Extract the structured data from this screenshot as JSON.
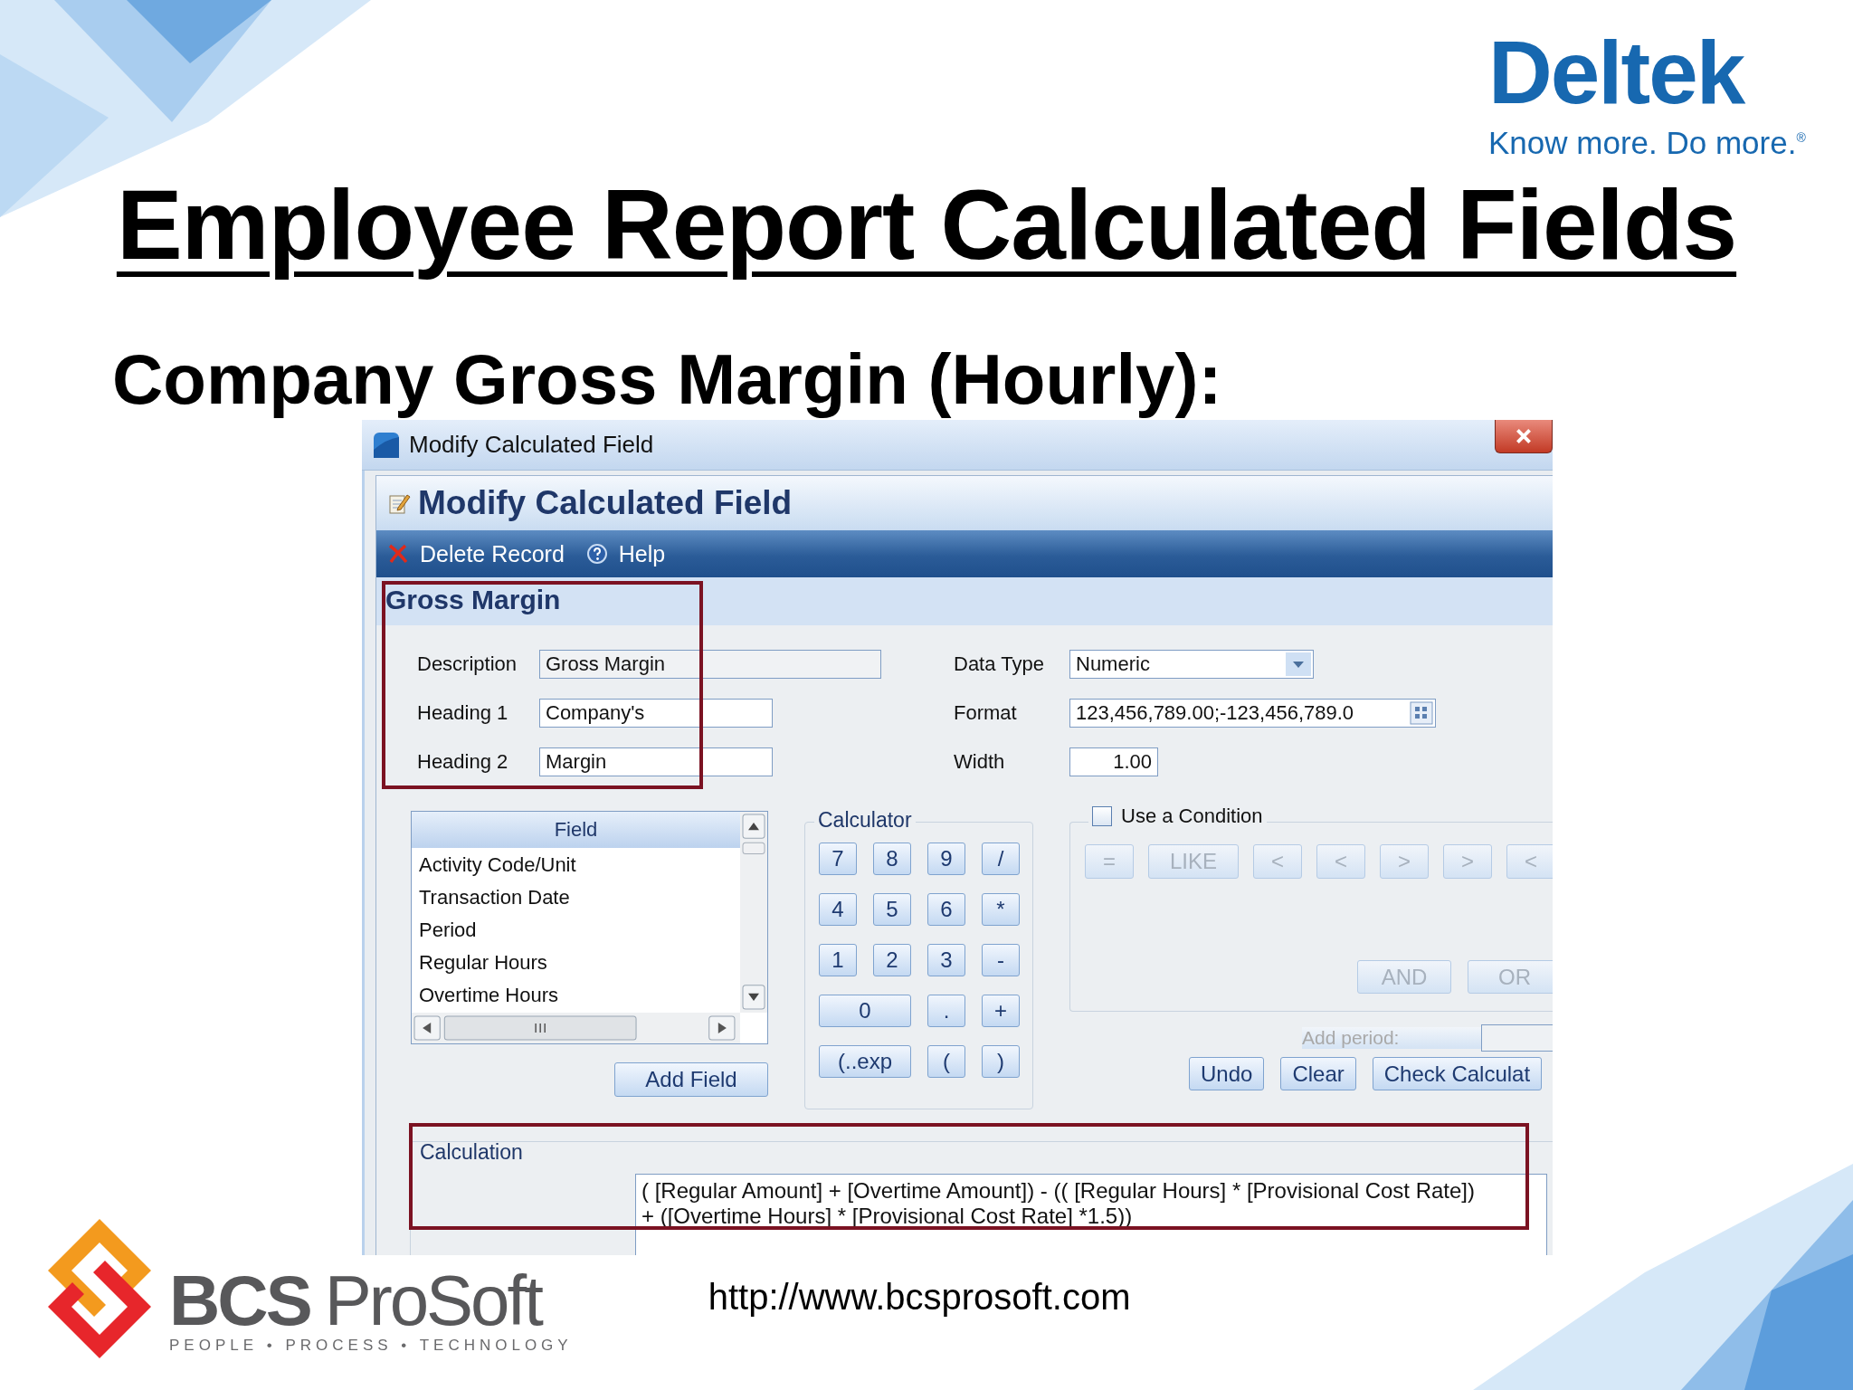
{
  "slide": {
    "brand_top": {
      "name": "Deltek",
      "tagline": "Know more. Do more.$^{®}$"
    },
    "title": "Employee Report Calculated Fields",
    "subtitle": "Company Gross Margin (Hourly):",
    "brand_bottom": {
      "name_bold": "BCS",
      "name": "ProSoft",
      "tagline": "PEOPLE • PROCESS • TECHNOLOGY"
    },
    "url": "http://www.bcsprosoft.com"
  },
  "window": {
    "title": "Modify Calculated Field"
  },
  "form": {
    "heading": "Modify Calculated Field",
    "toolbar": [
      {
        "kind": "delete",
        "label": "Delete Record"
      },
      {
        "kind": "help",
        "label": "Help"
      }
    ],
    "section": "Gross Margin",
    "fields_left": [
      {
        "label": "Description",
        "value": "Gross Margin",
        "disabled": true
      },
      {
        "label": "Heading 1",
        "value": "Company's",
        "disabled": false
      },
      {
        "label": "Heading 2",
        "value": "Margin",
        "disabled": false
      }
    ],
    "fields_right": [
      {
        "kind": "select",
        "label": "Data Type",
        "value": "Numeric"
      },
      {
        "kind": "picker",
        "label": "Format",
        "value": "123,456,789.00;-123,456,789.0"
      },
      {
        "kind": "number",
        "label": "Width",
        "value": "1.00"
      }
    ]
  },
  "field_list": {
    "header": "Field",
    "items": [
      "Activity Code/Unit",
      "Transaction Date",
      "Period",
      "Regular Hours",
      "Overtime Hours"
    ],
    "button": "Add Field"
  },
  "calculator": {
    "title": "Calculator",
    "keys": [
      {
        "label": "7",
        "kind": "key"
      },
      {
        "label": "8",
        "kind": "key"
      },
      {
        "label": "9",
        "kind": "key"
      },
      {
        "label": "/",
        "kind": "key"
      },
      {
        "label": "4",
        "kind": "key"
      },
      {
        "label": "5",
        "kind": "key"
      },
      {
        "label": "6",
        "kind": "key"
      },
      {
        "label": "*",
        "kind": "key"
      },
      {
        "label": "1",
        "kind": "key"
      },
      {
        "label": "2",
        "kind": "key"
      },
      {
        "label": "3",
        "kind": "key"
      },
      {
        "label": "-",
        "kind": "key"
      },
      {
        "label": "0",
        "kind": "wide"
      },
      {
        "label": ".",
        "kind": "key"
      },
      {
        "label": "+",
        "kind": "key"
      },
      {
        "label": "(..exp",
        "kind": "wide"
      },
      {
        "label": "(",
        "kind": "key"
      },
      {
        "label": ")",
        "kind": "key"
      }
    ]
  },
  "condition": {
    "label": "Use a Condition",
    "checked": false,
    "operators": [
      "=",
      "LIKE",
      "<",
      "<",
      ">",
      ">",
      "<"
    ],
    "logic": [
      "AND",
      "OR"
    ],
    "add_period": "Add period:"
  },
  "actions": [
    "Undo",
    "Clear",
    "Check Calculat"
  ],
  "calculation": {
    "label": "Calculation",
    "value": "( [Regular Amount] + [Overtime Amount]) - (( [Regular Hours] * [Provisional Cost Rate]) + ([Overtime Hours] * [Provisional Cost Rate] *1.5))"
  }
}
